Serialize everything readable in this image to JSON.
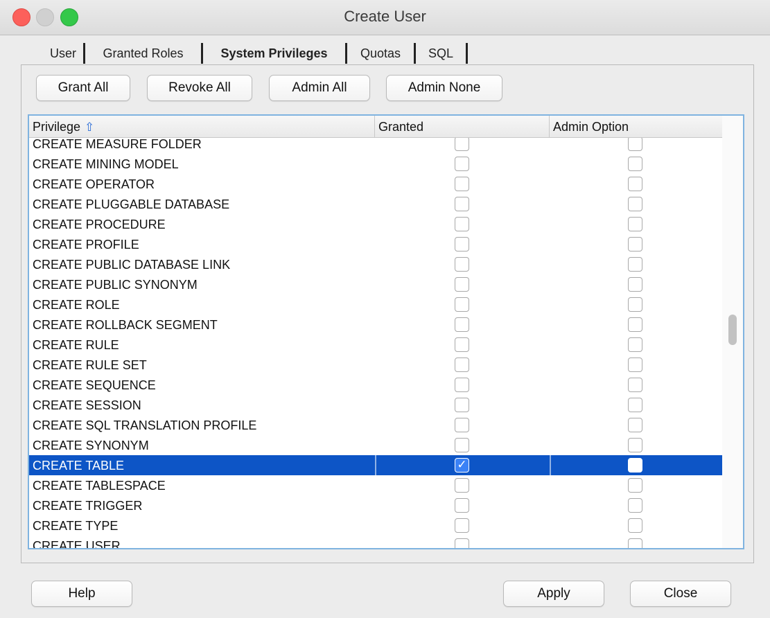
{
  "window": {
    "title": "Create User"
  },
  "tabs": [
    {
      "label": "User"
    },
    {
      "label": "Granted Roles"
    },
    {
      "label": "System Privileges"
    },
    {
      "label": "Quotas"
    },
    {
      "label": "SQL"
    }
  ],
  "active_tab_index": 2,
  "actions": {
    "grant_all": "Grant All",
    "revoke_all": "Revoke All",
    "admin_all": "Admin All",
    "admin_none": "Admin None"
  },
  "table": {
    "columns": [
      "Privilege",
      "Granted",
      "Admin Option"
    ],
    "sort_icon": "sort-ascending-arrow-icon",
    "rows": [
      {
        "privilege": "CREATE MEASURE FOLDER",
        "granted": false,
        "admin": false
      },
      {
        "privilege": "CREATE MINING MODEL",
        "granted": false,
        "admin": false
      },
      {
        "privilege": "CREATE OPERATOR",
        "granted": false,
        "admin": false
      },
      {
        "privilege": "CREATE PLUGGABLE DATABASE",
        "granted": false,
        "admin": false
      },
      {
        "privilege": "CREATE PROCEDURE",
        "granted": false,
        "admin": false
      },
      {
        "privilege": "CREATE PROFILE",
        "granted": false,
        "admin": false
      },
      {
        "privilege": "CREATE PUBLIC DATABASE LINK",
        "granted": false,
        "admin": false
      },
      {
        "privilege": "CREATE PUBLIC SYNONYM",
        "granted": false,
        "admin": false
      },
      {
        "privilege": "CREATE ROLE",
        "granted": false,
        "admin": false
      },
      {
        "privilege": "CREATE ROLLBACK SEGMENT",
        "granted": false,
        "admin": false
      },
      {
        "privilege": "CREATE RULE",
        "granted": false,
        "admin": false
      },
      {
        "privilege": "CREATE RULE SET",
        "granted": false,
        "admin": false
      },
      {
        "privilege": "CREATE SEQUENCE",
        "granted": false,
        "admin": false
      },
      {
        "privilege": "CREATE SESSION",
        "granted": false,
        "admin": false
      },
      {
        "privilege": "CREATE SQL TRANSLATION PROFILE",
        "granted": false,
        "admin": false
      },
      {
        "privilege": "CREATE SYNONYM",
        "granted": false,
        "admin": false
      },
      {
        "privilege": "CREATE TABLE",
        "granted": true,
        "admin": false,
        "selected": true
      },
      {
        "privilege": "CREATE TABLESPACE",
        "granted": false,
        "admin": false
      },
      {
        "privilege": "CREATE TRIGGER",
        "granted": false,
        "admin": false
      },
      {
        "privilege": "CREATE TYPE",
        "granted": false,
        "admin": false
      },
      {
        "privilege": "CREATE USER",
        "granted": false,
        "admin": false
      }
    ]
  },
  "footer": {
    "help": "Help",
    "apply": "Apply",
    "close": "Close"
  },
  "colors": {
    "selection": "#0d55c6",
    "table_border": "#7fb3e0"
  }
}
